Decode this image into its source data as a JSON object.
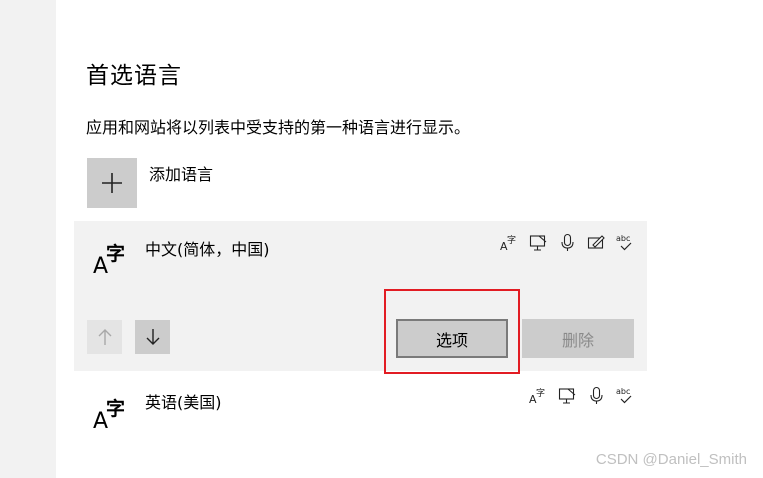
{
  "section": {
    "title": "首选语言",
    "description": "应用和网站将以列表中受支持的第一种语言进行显示。"
  },
  "add_language": {
    "label": "添加语言",
    "icon": "plus-icon"
  },
  "languages": [
    {
      "name": "中文(简体，中国)",
      "icon": "language-icon",
      "selected": true,
      "features": [
        "language-pack-icon",
        "text-to-speech-icon",
        "speech-recognition-icon",
        "handwriting-icon",
        "spell-check-icon"
      ]
    },
    {
      "name": "英语(美国)",
      "icon": "language-icon",
      "selected": false,
      "features": [
        "language-pack-icon",
        "text-to-speech-icon",
        "speech-recognition-icon",
        "spell-check-icon"
      ]
    }
  ],
  "controls": {
    "move_up_icon": "arrow-up-icon",
    "move_down_icon": "arrow-down-icon",
    "options_label": "选项",
    "remove_label": "删除"
  },
  "annotation": {
    "highlight_color": "#e21c23"
  },
  "watermark": "CSDN @Daniel_Smith",
  "colors": {
    "card_background": "#f2f2f2",
    "button_background": "#cccccc",
    "disabled_text": "#8a8a8a"
  }
}
